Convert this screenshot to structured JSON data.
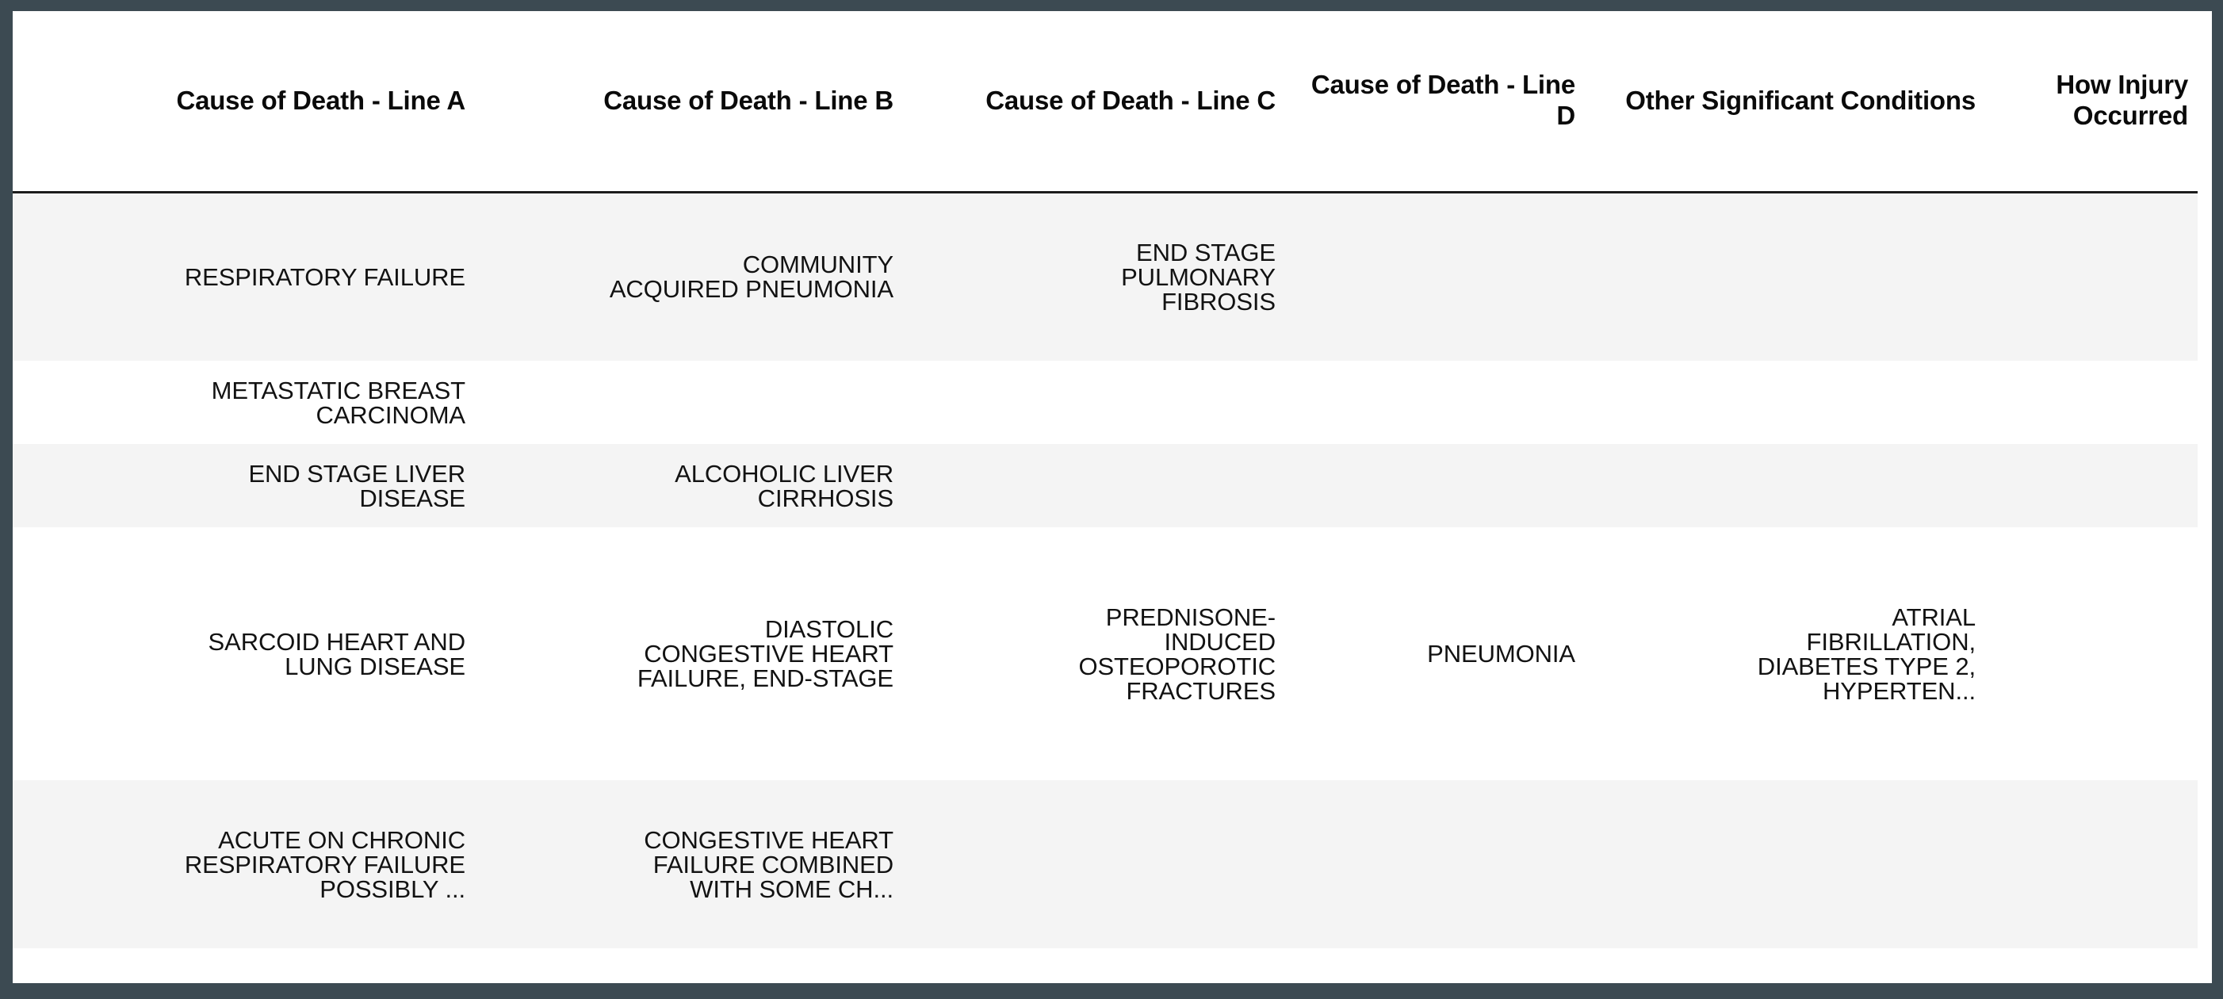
{
  "table": {
    "columns": [
      {
        "key": "line_a",
        "label": "Cause of Death - Line A"
      },
      {
        "key": "line_b",
        "label": "Cause of Death - Line B"
      },
      {
        "key": "line_c",
        "label": "Cause of Death - Line C"
      },
      {
        "key": "line_d",
        "label": "Cause of Death - Line D"
      },
      {
        "key": "other_conditions",
        "label": "Other Significant Conditions"
      },
      {
        "key": "how_injury",
        "label": "How Injury Occurred"
      }
    ],
    "rows": [
      {
        "line_a": "RESPIRATORY FAILURE",
        "line_b": "COMMUNITY\nACQUIRED PNEUMONIA",
        "line_c": "END STAGE\nPULMONARY\nFIBROSIS",
        "line_d": "",
        "other_conditions": "",
        "how_injury": ""
      },
      {
        "line_a": "METASTATIC BREAST\nCARCINOMA",
        "line_b": "",
        "line_c": "",
        "line_d": "",
        "other_conditions": "",
        "how_injury": ""
      },
      {
        "line_a": "END STAGE LIVER\nDISEASE",
        "line_b": "ALCOHOLIC LIVER\nCIRRHOSIS",
        "line_c": "",
        "line_d": "",
        "other_conditions": "",
        "how_injury": ""
      },
      {
        "line_a": "SARCOID HEART AND\nLUNG DISEASE",
        "line_b": "DIASTOLIC\nCONGESTIVE HEART\nFAILURE, END-STAGE",
        "line_c": "PREDNISONE-\nINDUCED\nOSTEOPOROTIC\nFRACTURES",
        "line_d": "PNEUMONIA",
        "other_conditions": "ATRIAL\nFIBRILLATION,\nDIABETES TYPE 2,\nHYPERTEN...",
        "how_injury": ""
      },
      {
        "line_a": "ACUTE ON CHRONIC\nRESPIRATORY FAILURE\nPOSSIBLY ...",
        "line_b": "CONGESTIVE HEART\nFAILURE COMBINED\nWITH SOME CH...",
        "line_c": "",
        "line_d": "",
        "other_conditions": "",
        "how_injury": ""
      }
    ]
  },
  "colors": {
    "page_background": "#3c4a52",
    "table_background": "#ffffff",
    "stripe_background": "#f4f4f4",
    "header_rule": "#1c1c1c",
    "text": "#121212"
  }
}
